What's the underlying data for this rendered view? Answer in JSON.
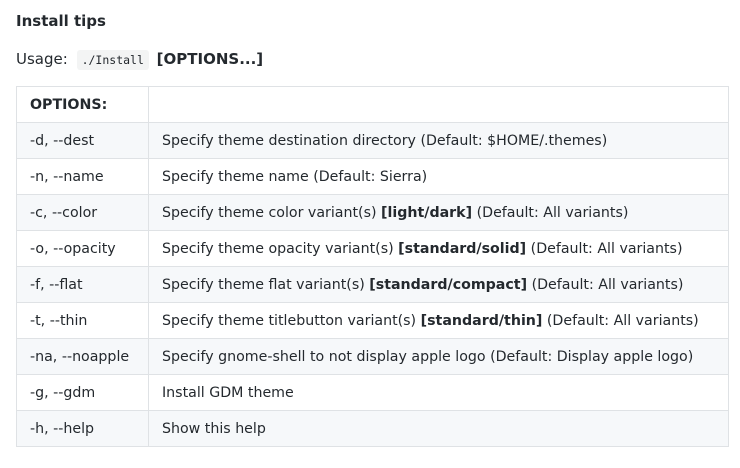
{
  "heading": "Install tips",
  "usage": {
    "label": "Usage:",
    "command": "./Install",
    "options": "[OPTIONS...]"
  },
  "table": {
    "header": [
      "OPTIONS:",
      ""
    ],
    "rows": [
      {
        "option": "-d, --dest",
        "desc_pre": "Specify theme destination directory (Default: $HOME/.themes)",
        "desc_bold": "",
        "desc_post": ""
      },
      {
        "option": "-n, --name",
        "desc_pre": "Specify theme name (Default: Sierra)",
        "desc_bold": "",
        "desc_post": ""
      },
      {
        "option": "-c, --color",
        "desc_pre": "Specify theme color variant(s) ",
        "desc_bold": "[light/dark]",
        "desc_post": " (Default: All variants)"
      },
      {
        "option": "-o, --opacity",
        "desc_pre": "Specify theme opacity variant(s) ",
        "desc_bold": "[standard/solid]",
        "desc_post": " (Default: All variants)"
      },
      {
        "option": "-f, --flat",
        "desc_pre": "Specify theme flat variant(s) ",
        "desc_bold": "[standard/compact]",
        "desc_post": " (Default: All variants)"
      },
      {
        "option": "-t, --thin",
        "desc_pre": "Specify theme titlebutton variant(s) ",
        "desc_bold": "[standard/thin]",
        "desc_post": " (Default: All variants)"
      },
      {
        "option": "-na, --noapple",
        "desc_pre": "Specify gnome-shell to not display apple logo (Default: Display apple logo)",
        "desc_bold": "",
        "desc_post": ""
      },
      {
        "option": "-g, --gdm",
        "desc_pre": "Install GDM theme",
        "desc_bold": "",
        "desc_post": ""
      },
      {
        "option": "-h, --help",
        "desc_pre": "Show this help",
        "desc_bold": "",
        "desc_post": ""
      }
    ]
  }
}
